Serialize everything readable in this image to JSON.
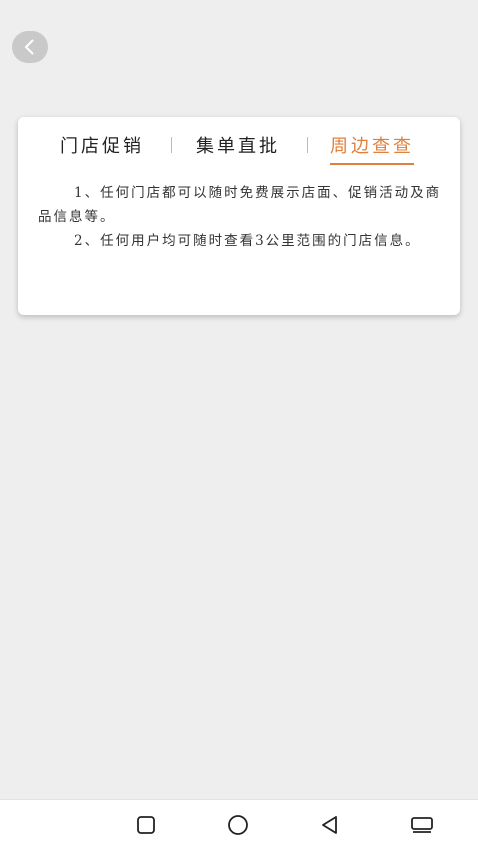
{
  "tabs": [
    {
      "label": "门店促销",
      "active": false
    },
    {
      "label": "集单直批",
      "active": false
    },
    {
      "label": "周边查查",
      "active": true
    }
  ],
  "content": {
    "paragraphs": [
      "1、任何门店都可以随时免费展示店面、促销活动及商品信息等。",
      "2、任何用户均可随时查看3公里范围的门店信息。"
    ]
  },
  "colors": {
    "accent": "#e0803a",
    "background": "#eeeeee",
    "card": "#ffffff"
  },
  "icons": {
    "back": "chevron-left-icon",
    "nav": [
      "square-icon",
      "circle-icon",
      "triangle-back-icon",
      "recent-apps-icon"
    ]
  }
}
